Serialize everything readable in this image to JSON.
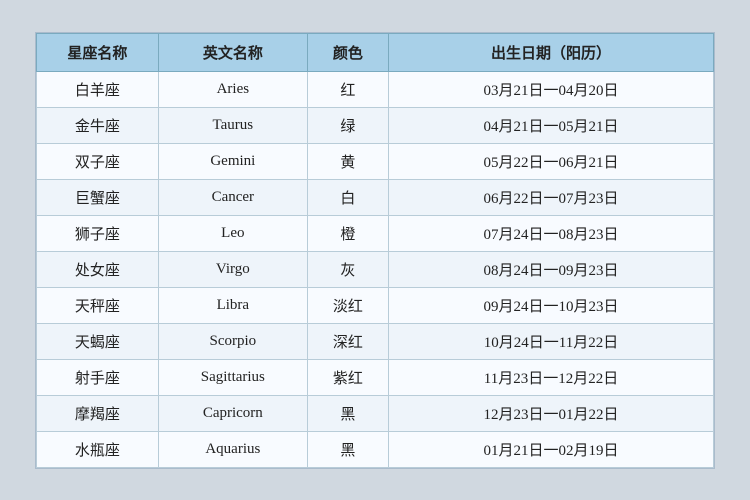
{
  "table": {
    "headers": [
      "星座名称",
      "英文名称",
      "颜色",
      "出生日期（阳历）"
    ],
    "rows": [
      {
        "chinese": "白羊座",
        "english": "Aries",
        "color": "红",
        "date": "03月21日一04月20日"
      },
      {
        "chinese": "金牛座",
        "english": "Taurus",
        "color": "绿",
        "date": "04月21日一05月21日"
      },
      {
        "chinese": "双子座",
        "english": "Gemini",
        "color": "黄",
        "date": "05月22日一06月21日"
      },
      {
        "chinese": "巨蟹座",
        "english": "Cancer",
        "color": "白",
        "date": "06月22日一07月23日"
      },
      {
        "chinese": "狮子座",
        "english": "Leo",
        "color": "橙",
        "date": "07月24日一08月23日"
      },
      {
        "chinese": "处女座",
        "english": "Virgo",
        "color": "灰",
        "date": "08月24日一09月23日"
      },
      {
        "chinese": "天秤座",
        "english": "Libra",
        "color": "淡红",
        "date": "09月24日一10月23日"
      },
      {
        "chinese": "天蝎座",
        "english": "Scorpio",
        "color": "深红",
        "date": "10月24日一11月22日"
      },
      {
        "chinese": "射手座",
        "english": "Sagittarius",
        "color": "紫红",
        "date": "11月23日一12月22日"
      },
      {
        "chinese": "摩羯座",
        "english": "Capricorn",
        "color": "黑",
        "date": "12月23日一01月22日"
      },
      {
        "chinese": "水瓶座",
        "english": "Aquarius",
        "color": "黑",
        "date": "01月21日一02月19日"
      }
    ]
  }
}
